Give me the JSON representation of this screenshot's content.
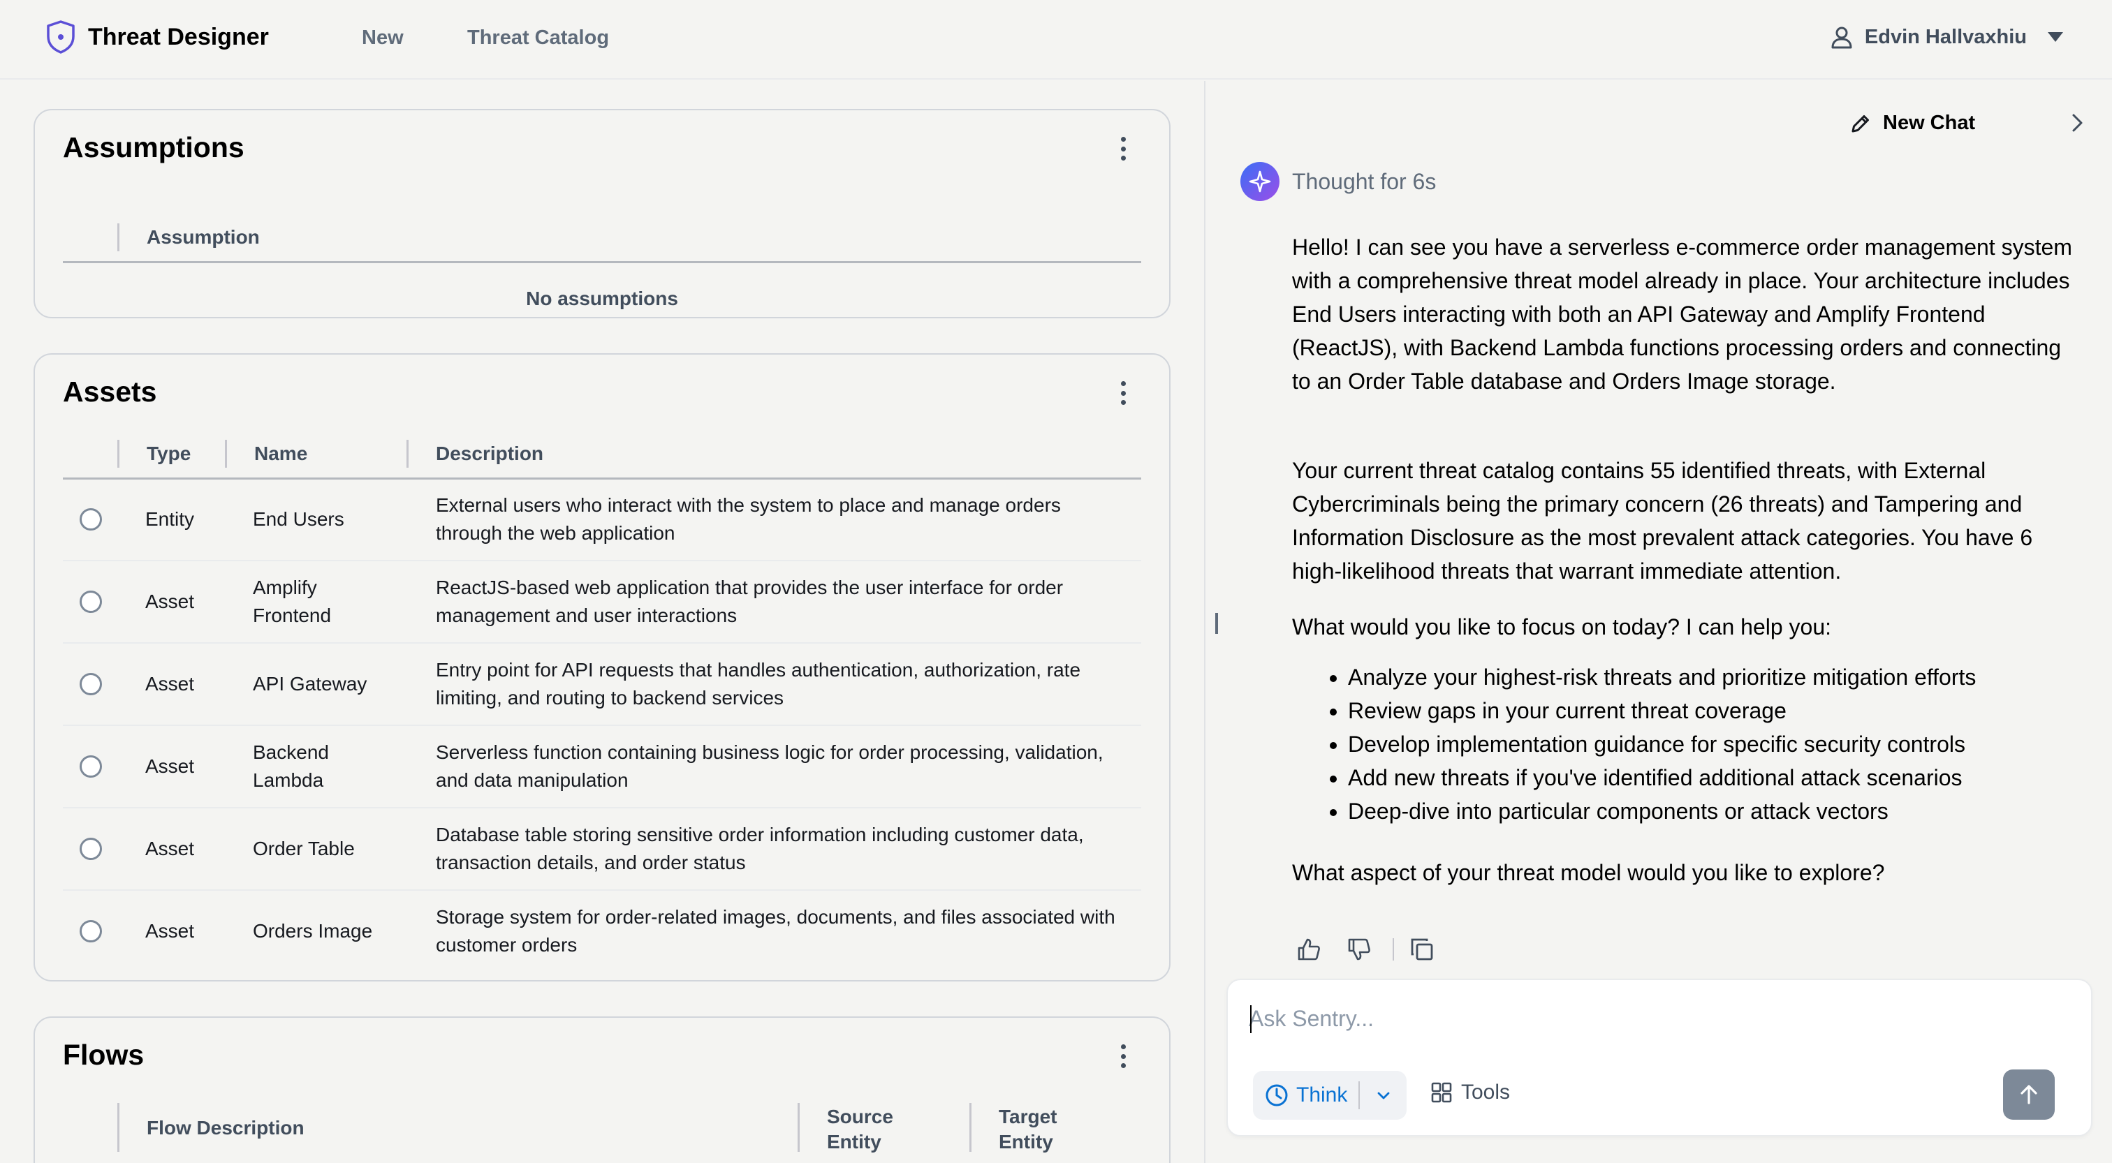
{
  "nav": {
    "app_title": "Threat Designer",
    "links": [
      "New",
      "Threat Catalog"
    ],
    "user_name": "Edvin Hallvaxhiu"
  },
  "assumptions": {
    "title": "Assumptions",
    "column": "Assumption",
    "empty_text": "No assumptions"
  },
  "assets": {
    "title": "Assets",
    "columns": [
      "Type",
      "Name",
      "Description"
    ],
    "rows": [
      {
        "type": "Entity",
        "name": "End Users",
        "description": "External users who interact with the system to place and manage orders through the web application"
      },
      {
        "type": "Asset",
        "name": "Amplify Frontend",
        "description": "ReactJS-based web application that provides the user interface for order management and user interactions"
      },
      {
        "type": "Asset",
        "name": "API Gateway",
        "description": "Entry point for API requests that handles authentication, authorization, rate limiting, and routing to backend services"
      },
      {
        "type": "Asset",
        "name": "Backend Lambda",
        "description": "Serverless function containing business logic for order processing, validation, and data manipulation"
      },
      {
        "type": "Asset",
        "name": "Order Table",
        "description": "Database table storing sensitive order information including customer data, transaction details, and order status"
      },
      {
        "type": "Asset",
        "name": "Orders Image",
        "description": "Storage system for order-related images, documents, and files associated with customer orders"
      }
    ]
  },
  "flows": {
    "title": "Flows",
    "columns": [
      "Flow Description",
      "Source Entity",
      "Target Entity"
    ]
  },
  "chat": {
    "new_chat_label": "New Chat",
    "thought_label": "Thought for 6s",
    "paragraphs": [
      "Hello! I can see you have a serverless e-commerce order management system with a comprehensive threat model already in place. Your architecture includes End Users interacting with both an API Gateway and Amplify Frontend (ReactJS), with Backend Lambda functions processing orders and connecting to an Order Table database and Orders Image storage.",
      "Your current threat catalog contains 55 identified threats, with External Cybercriminals being the primary concern (26 threats) and Tampering and Information Disclosure as the most prevalent attack categories. You have 6 high-likelihood threats that warrant immediate attention.",
      "What would you like to focus on today? I can help you:"
    ],
    "bullets": [
      "Analyze your highest-risk threats and prioritize mitigation efforts",
      "Review gaps in your current threat coverage",
      "Develop implementation guidance for specific security controls",
      "Add new threats if you've identified additional attack scenarios",
      "Deep-dive into particular components or attack vectors"
    ],
    "closing": "What aspect of your threat model would you like to explore?",
    "input_placeholder": "Ask Sentry...",
    "input_value": "",
    "think_label": "Think",
    "tools_label": "Tools"
  },
  "colors": {
    "accent": "#0972d3",
    "avatar_gradient_start": "#3b6ef5",
    "avatar_gradient_end": "#9b4ee8",
    "send_button": "#7d8998"
  },
  "icons": [
    "shield-logo-icon",
    "user-icon",
    "caret-down-icon",
    "kebab-menu-icon",
    "pencil-icon",
    "chevron-right-icon",
    "sparkle-icon",
    "thumbs-up-icon",
    "thumbs-down-icon",
    "copy-icon",
    "clock-icon",
    "chevron-down-icon",
    "grid-icon",
    "arrow-up-icon"
  ]
}
